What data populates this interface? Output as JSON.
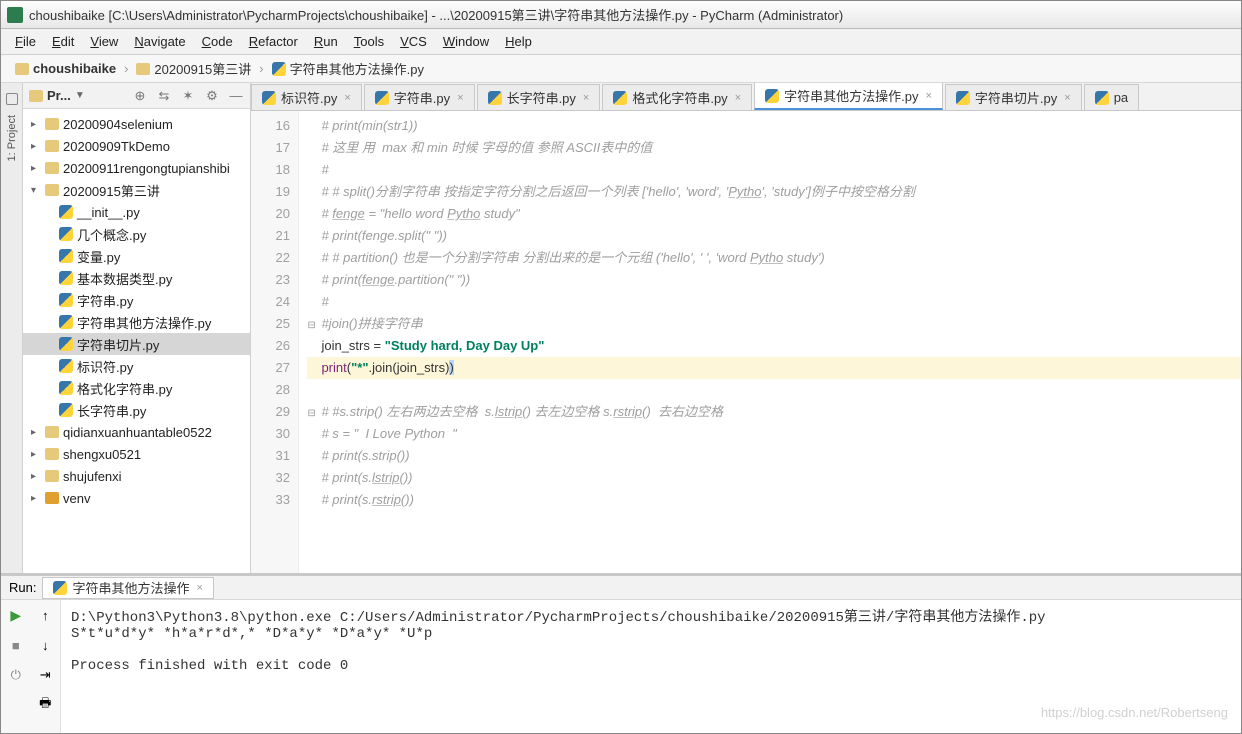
{
  "title": "choushibaike [C:\\Users\\Administrator\\PycharmProjects\\choushibaike] - ...\\20200915第三讲\\字符串其他方法操作.py - PyCharm (Administrator)",
  "menu": [
    "File",
    "Edit",
    "View",
    "Navigate",
    "Code",
    "Refactor",
    "Run",
    "Tools",
    "VCS",
    "Window",
    "Help"
  ],
  "breadcrumbs": {
    "root": "choushibaike",
    "folder": "20200915第三讲",
    "file": "字符串其他方法操作.py"
  },
  "project_panel": {
    "label": "Pr...",
    "side_label": "1: Project"
  },
  "tree": [
    {
      "t": "folder",
      "name": "20200904selenium",
      "lvl": 0
    },
    {
      "t": "folder",
      "name": "20200909TkDemo",
      "lvl": 0
    },
    {
      "t": "folder",
      "name": "20200911rengongtupianshibi",
      "lvl": 0
    },
    {
      "t": "folder",
      "name": "20200915第三讲",
      "lvl": 0,
      "open": true
    },
    {
      "t": "py",
      "name": "__init__.py",
      "lvl": 1
    },
    {
      "t": "py",
      "name": "几个概念.py",
      "lvl": 1
    },
    {
      "t": "py",
      "name": "变量.py",
      "lvl": 1
    },
    {
      "t": "py",
      "name": "基本数据类型.py",
      "lvl": 1
    },
    {
      "t": "py",
      "name": "字符串.py",
      "lvl": 1
    },
    {
      "t": "py",
      "name": "字符串其他方法操作.py",
      "lvl": 1
    },
    {
      "t": "py",
      "name": "字符串切片.py",
      "lvl": 1,
      "sel": true
    },
    {
      "t": "py",
      "name": "标识符.py",
      "lvl": 1
    },
    {
      "t": "py",
      "name": "格式化字符串.py",
      "lvl": 1
    },
    {
      "t": "py",
      "name": "长字符串.py",
      "lvl": 1
    },
    {
      "t": "folder",
      "name": "qidianxuanhuantable0522",
      "lvl": 0
    },
    {
      "t": "folder",
      "name": "shengxu0521",
      "lvl": 0
    },
    {
      "t": "folder",
      "name": "shujufenxi",
      "lvl": 0
    },
    {
      "t": "venv",
      "name": "venv",
      "lvl": 0
    }
  ],
  "tabs": [
    {
      "label": "标识符.py"
    },
    {
      "label": "字符串.py"
    },
    {
      "label": "长字符串.py"
    },
    {
      "label": "格式化字符串.py"
    },
    {
      "label": "字符串其他方法操作.py",
      "active": true
    },
    {
      "label": "字符串切片.py"
    },
    {
      "label": "pa",
      "cut": true
    }
  ],
  "code": {
    "start": 16,
    "lines": [
      {
        "n": 16,
        "seg": [
          {
            "c": "cm",
            "t": "# print(min(str1))"
          }
        ]
      },
      {
        "n": 17,
        "seg": [
          {
            "c": "cm",
            "t": "# 这里 用  max 和 min 时候 字母的值 参照 ASCII表中的值"
          }
        ]
      },
      {
        "n": 18,
        "seg": [
          {
            "c": "cm",
            "t": "#"
          }
        ]
      },
      {
        "n": 19,
        "seg": [
          {
            "c": "cm",
            "t": "# # split()分割字符串 按指定字符分割之后返回一个列表 ['hello', 'word', '"
          },
          {
            "c": "cm ul",
            "t": "Pytho"
          },
          {
            "c": "cm",
            "t": "', 'study']例子中按空格分割"
          }
        ]
      },
      {
        "n": 20,
        "seg": [
          {
            "c": "cm",
            "t": "# "
          },
          {
            "c": "cm ul",
            "t": "fenge"
          },
          {
            "c": "cm",
            "t": " = \"hello word "
          },
          {
            "c": "cm ul",
            "t": "Pytho"
          },
          {
            "c": "cm",
            "t": " study\""
          }
        ]
      },
      {
        "n": 21,
        "seg": [
          {
            "c": "cm",
            "t": "# print(fenge.split(\" \"))"
          }
        ]
      },
      {
        "n": 22,
        "seg": [
          {
            "c": "cm",
            "t": "# # partition() 也是一个分割字符串 分割出来的是一个元组 ('hello', ' ', 'word "
          },
          {
            "c": "cm ul",
            "t": "Pytho"
          },
          {
            "c": "cm",
            "t": " study')"
          }
        ]
      },
      {
        "n": 23,
        "seg": [
          {
            "c": "cm",
            "t": "# print("
          },
          {
            "c": "cm ul",
            "t": "fenge"
          },
          {
            "c": "cm",
            "t": ".partition(\" \"))"
          }
        ]
      },
      {
        "n": 24,
        "seg": [
          {
            "c": "cm",
            "t": "#"
          }
        ]
      },
      {
        "n": 25,
        "fold": true,
        "seg": [
          {
            "c": "cm",
            "t": "#join()拼接字符串"
          }
        ]
      },
      {
        "n": 26,
        "seg": [
          {
            "c": "id",
            "t": "join_strs "
          },
          {
            "c": "pun",
            "t": "= "
          },
          {
            "c": "str",
            "t": "\"Study hard, Day Day Up\""
          }
        ]
      },
      {
        "n": 27,
        "hl": true,
        "seg": [
          {
            "c": "fn",
            "t": "print"
          },
          {
            "c": "pun",
            "t": "("
          },
          {
            "c": "str",
            "t": "\"*\""
          },
          {
            "c": "pun",
            "t": "."
          },
          {
            "c": "id",
            "t": "join"
          },
          {
            "c": "pun",
            "t": "(join_strs)"
          },
          {
            "c": "sel",
            "t": ")"
          }
        ]
      },
      {
        "n": 28,
        "seg": [
          {
            "c": "",
            "t": ""
          }
        ]
      },
      {
        "n": 29,
        "fold": true,
        "seg": [
          {
            "c": "cm",
            "t": "# #s.strip() 左右两边去空格  s."
          },
          {
            "c": "cm ul",
            "t": "lstrip"
          },
          {
            "c": "cm",
            "t": "() 去左边空格 s."
          },
          {
            "c": "cm ul",
            "t": "rstrip"
          },
          {
            "c": "cm",
            "t": "()  去右边空格"
          }
        ]
      },
      {
        "n": 30,
        "seg": [
          {
            "c": "cm",
            "t": "# s = \"  I Love Python  \""
          }
        ]
      },
      {
        "n": 31,
        "seg": [
          {
            "c": "cm",
            "t": "# print(s.strip())"
          }
        ]
      },
      {
        "n": 32,
        "seg": [
          {
            "c": "cm",
            "t": "# print(s."
          },
          {
            "c": "cm ul",
            "t": "lstrip"
          },
          {
            "c": "cm",
            "t": "())"
          }
        ]
      },
      {
        "n": 33,
        "seg": [
          {
            "c": "cm",
            "t": "# print(s."
          },
          {
            "c": "cm ul",
            "t": "rstrip"
          },
          {
            "c": "cm",
            "t": "())"
          }
        ]
      }
    ]
  },
  "run": {
    "label": "Run:",
    "tab": "字符串其他方法操作",
    "out": [
      "D:\\Python3\\Python3.8\\python.exe C:/Users/Administrator/PycharmProjects/choushibaike/20200915第三讲/字符串其他方法操作.py",
      "S*t*u*d*y* *h*a*r*d*,* *D*a*y* *D*a*y* *U*p",
      "",
      "Process finished with exit code 0"
    ]
  },
  "watermark": "https://blog.csdn.net/Robertseng"
}
